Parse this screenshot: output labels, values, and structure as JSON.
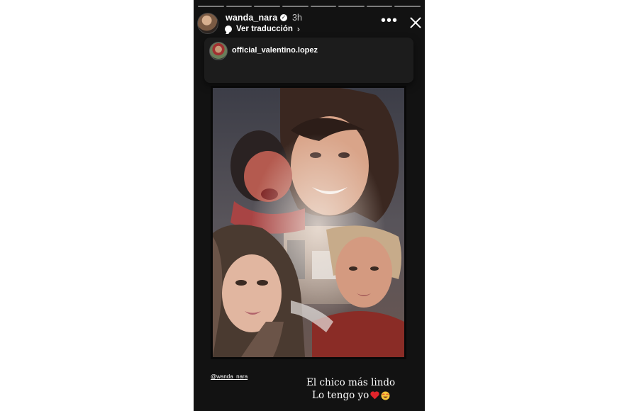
{
  "story": {
    "progress_segments": 8,
    "author": {
      "username": "wanda_nara",
      "verified": true,
      "time": "3h"
    },
    "translate": {
      "label": "Ver traducción"
    },
    "repost": {
      "username": "official_valentino.lopez"
    },
    "photo": {
      "icon": "photo-collage"
    },
    "caption": {
      "mention": "@wanda_nara",
      "line1": "El chico más lindo",
      "line2": "Lo tengo yo",
      "emojis": [
        "red-heart-icon",
        "heart-eyes-icon"
      ]
    },
    "colors": {
      "background": "#121212",
      "card": "#1c1c1c",
      "text": "#ffffff",
      "heart": "#e0242b"
    }
  }
}
